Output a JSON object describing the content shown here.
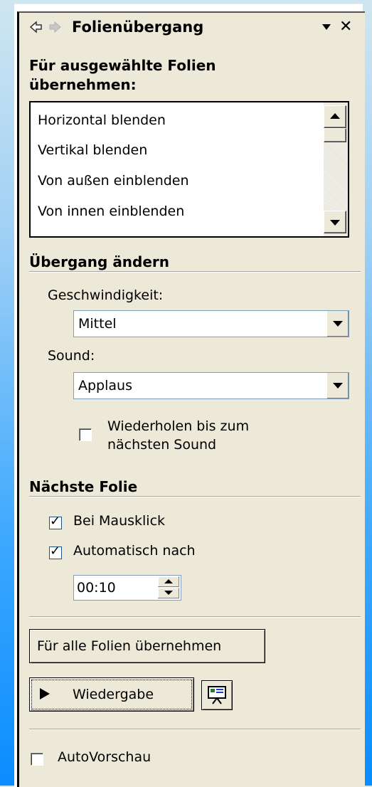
{
  "title": "Folienübergang",
  "apply_section": {
    "heading": "Für ausgewählte Folien übernehmen:",
    "heading_line1": "Für ausgewählte Folien",
    "heading_line2": "übernehmen:",
    "transitions": [
      "Horizontal blenden",
      "Vertikal blenden",
      "Von außen einblenden",
      "Von innen einblenden"
    ]
  },
  "modify_section": {
    "heading": "Übergang ändern",
    "speed_label": "Geschwindigkeit:",
    "speed_value": "Mittel",
    "sound_label": "Sound:",
    "sound_value": "Applaus",
    "loop_checkbox": {
      "label_line1": "Wiederholen bis zum",
      "label_line2": "nächsten Sound",
      "checked": false
    }
  },
  "next_slide_section": {
    "heading": "Nächste Folie",
    "on_click": {
      "label": "Bei Mausklick",
      "checked": true
    },
    "automatic": {
      "label": "Automatisch nach",
      "checked": true
    },
    "time_value": "00:10"
  },
  "buttons": {
    "apply_all": "Für alle Folien übernehmen",
    "play": "Wiedergabe"
  },
  "autopreview": {
    "label": "AutoVorschau",
    "checked": false
  },
  "icons": {
    "back": "back-arrow-icon",
    "forward": "forward-arrow-icon",
    "menu": "dropdown-triangle-icon",
    "close": "close-icon",
    "play": "play-triangle-icon",
    "slideshow": "slideshow-icon"
  }
}
